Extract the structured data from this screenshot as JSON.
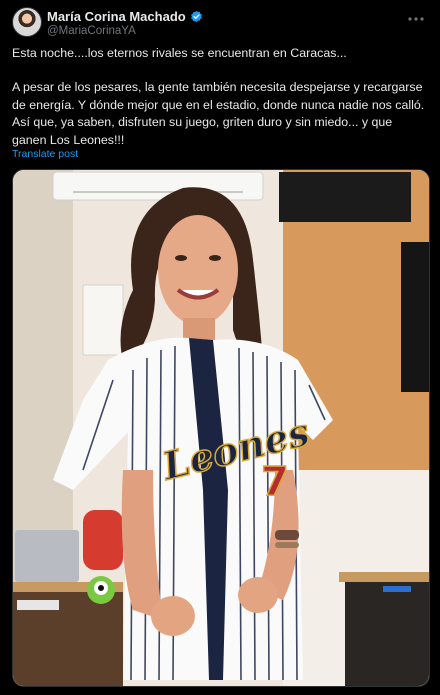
{
  "author": {
    "name": "María Corina Machado",
    "handle": "@MariaCorinaYA",
    "verified": true
  },
  "post": {
    "line1": "Esta noche....los eternos rivales se encuentran en Caracas...",
    "line2": "A pesar de los pesares, la gente también necesita despejarse y recargarse de energía. Y dónde mejor que en el estadio, donde nunca nadie nos calló. Así que, ya saben, disfruten su juego, griten duro y sin miedo... y que ganen Los Leones!!!",
    "translate": "Translate post"
  },
  "photo": {
    "jersey_text": "Leones",
    "jersey_number": "7"
  },
  "icons": {
    "more": "more-icon",
    "verified": "verified-badge-icon"
  },
  "colors": {
    "background": "#000000",
    "text": "#e7e9ea",
    "muted": "#71767b",
    "link": "#1d9bf0"
  }
}
